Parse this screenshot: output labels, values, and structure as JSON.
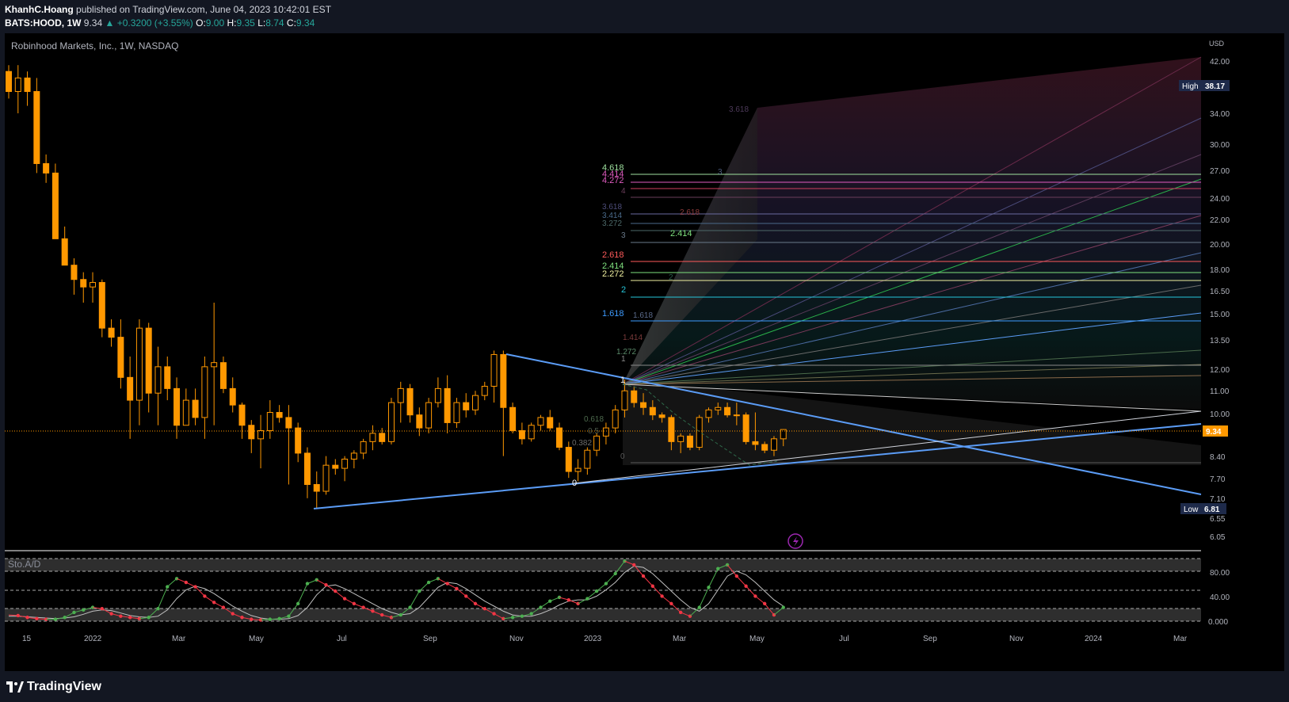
{
  "header": {
    "author": "KhanhC.Hoang",
    "published": "published on TradingView.com, June 04, 2023 10:42:01 EST",
    "symbol": "BATS:HOOD, 1W",
    "price": "9.34",
    "change": "▲ +0.3200 (+3.55%)",
    "o_label": "O:",
    "o": "9.00",
    "h_label": "H:",
    "h": "9.35",
    "l_label": "L:",
    "l": "8.74",
    "c_label": "C:",
    "c": "9.34"
  },
  "chart_title": "Robinhood Markets, Inc., 1W, NASDAQ",
  "currency": "USD",
  "price_axis": [
    "42.00",
    "34.00",
    "30.00",
    "27.00",
    "24.00",
    "22.00",
    "20.00",
    "18.00",
    "16.50",
    "15.00",
    "13.50",
    "12.00",
    "11.00",
    "10.00",
    "8.40",
    "7.70",
    "7.10",
    "6.55",
    "6.05"
  ],
  "badges": {
    "high_label": "High",
    "high_value": "38.17",
    "last": "9.34",
    "low_label": "Low",
    "low_value": "6.81"
  },
  "fib_labels": [
    "4.618",
    "4.414",
    "4.272",
    "4",
    "3.618",
    "3.414",
    "3.272",
    "3",
    "2.618",
    "2.414",
    "2.272",
    "2",
    "1.618",
    "1.414",
    "1.272",
    "1",
    "0.618",
    "0.5",
    "0.382",
    "0"
  ],
  "fan_labels": [
    "3.618",
    "3",
    "2.618",
    "2.414",
    "2",
    "1.618"
  ],
  "indicator": {
    "name": "Sto.A/D",
    "axis": [
      "80.00",
      "40.00",
      "0.000"
    ]
  },
  "time_axis": [
    "15",
    "2022",
    "Mar",
    "May",
    "Jul",
    "Sep",
    "Nov",
    "2023",
    "Mar",
    "May",
    "Jul",
    "Sep",
    "Nov",
    "2024",
    "Mar"
  ],
  "footer": {
    "logo": "TradingView"
  },
  "colors": {
    "up": "#26a69a",
    "candle": "#ff9800",
    "trend": "#5b9cf6",
    "bg": "#000000"
  },
  "chart_data": {
    "type": "candlestick",
    "title": "Robinhood Markets, Inc., 1W, NASDAQ",
    "high": 38.17,
    "low": 6.81,
    "last": 9.34,
    "candles": [
      [
        39,
        40,
        35,
        36
      ],
      [
        36,
        40,
        33,
        38
      ],
      [
        38,
        39,
        34,
        36
      ],
      [
        36,
        38,
        26,
        27
      ],
      [
        27,
        28,
        25,
        26
      ],
      [
        26,
        27,
        20,
        20
      ],
      [
        20,
        21,
        18,
        18
      ],
      [
        18,
        18.5,
        16,
        17
      ],
      [
        17,
        17.5,
        15.5,
        16.5
      ],
      [
        16.5,
        17.5,
        15.5,
        16.8
      ],
      [
        16.8,
        17,
        13.5,
        14
      ],
      [
        14,
        14.5,
        13,
        13.5
      ],
      [
        13.5,
        14.5,
        11,
        11.5
      ],
      [
        11.5,
        12.5,
        9,
        10.5
      ],
      [
        10.5,
        14.5,
        9.5,
        14
      ],
      [
        14,
        14.3,
        10,
        10.8
      ],
      [
        10.8,
        13,
        9.5,
        12
      ],
      [
        12,
        12.5,
        10.5,
        11
      ],
      [
        11,
        11.5,
        9,
        9.5
      ],
      [
        9.5,
        11,
        9.5,
        10.5
      ],
      [
        10.5,
        11,
        9.5,
        9.8
      ],
      [
        9.8,
        12.5,
        9,
        12
      ],
      [
        12,
        15.5,
        9.5,
        12.2
      ],
      [
        12.2,
        12.5,
        10.8,
        11
      ],
      [
        11,
        11.5,
        10,
        10.3
      ],
      [
        10.3,
        10.4,
        9,
        9.5
      ],
      [
        9.5,
        9.7,
        8.5,
        9
      ],
      [
        9,
        9.9,
        8,
        9.3
      ],
      [
        9.3,
        10.5,
        9,
        10
      ],
      [
        10,
        10.3,
        9.6,
        9.8
      ],
      [
        9.8,
        10.3,
        7.5,
        9.4
      ],
      [
        9.4,
        9.6,
        8.2,
        8.5
      ],
      [
        8.5,
        8.7,
        7.1,
        7.5
      ],
      [
        7.5,
        7.9,
        6.81,
        7.3
      ],
      [
        7.3,
        8.4,
        7.2,
        8.1
      ],
      [
        8.1,
        8.3,
        7.8,
        8
      ],
      [
        8,
        8.4,
        7.6,
        8.3
      ],
      [
        8.3,
        8.6,
        8,
        8.5
      ],
      [
        8.5,
        9,
        8.3,
        8.9
      ],
      [
        8.9,
        9.5,
        8.6,
        9.2
      ],
      [
        9.2,
        9.4,
        8.8,
        8.9
      ],
      [
        8.9,
        10.6,
        8.8,
        10.4
      ],
      [
        10.4,
        11.3,
        9.6,
        11
      ],
      [
        11,
        11.2,
        9.6,
        9.9
      ],
      [
        9.9,
        10.2,
        9.1,
        9.4
      ],
      [
        9.4,
        10.6,
        9.2,
        10.4
      ],
      [
        10.4,
        11.5,
        10.2,
        11
      ],
      [
        11,
        11.6,
        9.2,
        9.6
      ],
      [
        9.6,
        10.6,
        9.4,
        10.4
      ],
      [
        10.4,
        10.8,
        9.8,
        10.1
      ],
      [
        10.1,
        10.9,
        9.9,
        10.7
      ],
      [
        10.7,
        11.3,
        10.5,
        11.1
      ],
      [
        11.1,
        12.8,
        10.4,
        12.6
      ],
      [
        12.6,
        12.8,
        8.4,
        10.2
      ],
      [
        10.2,
        10.4,
        9.2,
        9.3
      ],
      [
        9.3,
        9.6,
        8.8,
        9
      ],
      [
        9,
        9.6,
        8.9,
        9.5
      ],
      [
        9.5,
        9.9,
        9.3,
        9.8
      ],
      [
        9.8,
        10.1,
        9.3,
        9.4
      ],
      [
        9.4,
        9.6,
        8.6,
        8.7
      ],
      [
        8.7,
        8.9,
        7.7,
        7.9
      ],
      [
        7.9,
        8.3,
        7.6,
        8
      ],
      [
        8,
        8.7,
        7.8,
        8.6
      ],
      [
        8.6,
        9.2,
        8.4,
        9.1
      ],
      [
        9.1,
        9.6,
        8.8,
        9.4
      ],
      [
        9.4,
        10.3,
        9.2,
        10.1
      ],
      [
        10.1,
        11.4,
        9.8,
        10.9
      ],
      [
        10.9,
        11.1,
        10.2,
        10.4
      ],
      [
        10.4,
        10.8,
        9.9,
        10.2
      ],
      [
        10.2,
        10.5,
        9.7,
        9.9
      ],
      [
        9.9,
        10,
        9.6,
        9.8
      ],
      [
        9.8,
        9.9,
        8.6,
        8.9
      ],
      [
        8.9,
        9.2,
        8.5,
        9.1
      ],
      [
        9.1,
        9.2,
        8.6,
        8.7
      ],
      [
        8.7,
        9.9,
        8.6,
        9.8
      ],
      [
        9.8,
        10.2,
        9.6,
        10.1
      ],
      [
        10.1,
        10.4,
        9.9,
        10.2
      ],
      [
        10.2,
        10.4,
        9.8,
        9.9
      ],
      [
        9.9,
        10.4,
        9.5,
        9.9
      ],
      [
        9.9,
        10,
        8.8,
        8.9
      ],
      [
        8.9,
        10,
        8.6,
        8.8
      ],
      [
        8.8,
        8.9,
        8.5,
        8.6
      ],
      [
        8.6,
        9.1,
        8.4,
        9
      ],
      [
        9,
        9.35,
        8.74,
        9.34
      ]
    ],
    "stoch": {
      "fast": [
        10,
        9,
        6,
        4,
        3,
        3,
        6,
        14,
        18,
        22,
        20,
        12,
        8,
        6,
        4,
        6,
        20,
        55,
        68,
        62,
        55,
        40,
        30,
        22,
        12,
        6,
        3,
        2,
        3,
        4,
        8,
        28,
        60,
        66,
        58,
        48,
        36,
        28,
        22,
        16,
        10,
        6,
        10,
        22,
        48,
        62,
        68,
        60,
        52,
        40,
        28,
        20,
        12,
        4,
        6,
        8,
        12,
        22,
        32,
        38,
        34,
        28,
        36,
        48,
        60,
        76,
        96,
        90,
        72,
        56,
        40,
        28,
        14,
        8,
        22,
        54,
        84,
        90,
        72,
        56,
        40,
        28,
        10,
        22
      ],
      "slow": [
        8,
        8,
        7,
        6,
        5,
        4,
        5,
        7,
        11,
        16,
        18,
        17,
        13,
        9,
        7,
        6,
        8,
        18,
        36,
        50,
        56,
        52,
        44,
        34,
        24,
        16,
        9,
        5,
        3,
        3,
        4,
        9,
        22,
        42,
        56,
        58,
        52,
        44,
        36,
        28,
        20,
        14,
        10,
        12,
        22,
        38,
        54,
        62,
        60,
        52,
        42,
        32,
        24,
        16,
        10,
        8,
        8,
        12,
        18,
        26,
        32,
        34,
        34,
        40,
        50,
        62,
        78,
        88,
        86,
        76,
        62,
        48,
        34,
        22,
        16,
        28,
        50,
        72,
        80,
        74,
        62,
        48,
        34,
        24
      ]
    }
  }
}
